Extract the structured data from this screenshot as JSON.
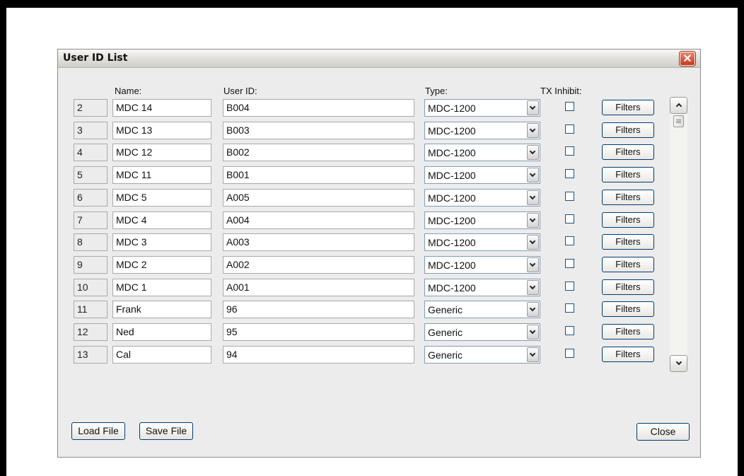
{
  "window": {
    "title": "User ID List",
    "close_glyph": "✕"
  },
  "columns": {
    "name": "Name:",
    "user_id": "User ID:",
    "type": "Type:",
    "tx_inhibit": "TX Inhibit:"
  },
  "rows": [
    {
      "num": "2",
      "name": "MDC 14",
      "user_id": "B004",
      "type": "MDC-1200",
      "tx_inhibit": false,
      "filters": "Filters"
    },
    {
      "num": "3",
      "name": "MDC 13",
      "user_id": "B003",
      "type": "MDC-1200",
      "tx_inhibit": false,
      "filters": "Filters"
    },
    {
      "num": "4",
      "name": "MDC 12",
      "user_id": "B002",
      "type": "MDC-1200",
      "tx_inhibit": false,
      "filters": "Filters"
    },
    {
      "num": "5",
      "name": "MDC 11",
      "user_id": "B001",
      "type": "MDC-1200",
      "tx_inhibit": false,
      "filters": "Filters"
    },
    {
      "num": "6",
      "name": "MDC 5",
      "user_id": "A005",
      "type": "MDC-1200",
      "tx_inhibit": false,
      "filters": "Filters"
    },
    {
      "num": "7",
      "name": "MDC 4",
      "user_id": "A004",
      "type": "MDC-1200",
      "tx_inhibit": false,
      "filters": "Filters"
    },
    {
      "num": "8",
      "name": "MDC 3",
      "user_id": "A003",
      "type": "MDC-1200",
      "tx_inhibit": false,
      "filters": "Filters"
    },
    {
      "num": "9",
      "name": "MDC 2",
      "user_id": "A002",
      "type": "MDC-1200",
      "tx_inhibit": false,
      "filters": "Filters"
    },
    {
      "num": "10",
      "name": "MDC 1",
      "user_id": "A001",
      "type": "MDC-1200",
      "tx_inhibit": false,
      "filters": "Filters"
    },
    {
      "num": "11",
      "name": "Frank",
      "user_id": "96",
      "type": "Generic",
      "tx_inhibit": false,
      "filters": "Filters"
    },
    {
      "num": "12",
      "name": "Ned",
      "user_id": "95",
      "type": "Generic",
      "tx_inhibit": false,
      "filters": "Filters"
    },
    {
      "num": "13",
      "name": "Cal",
      "user_id": "94",
      "type": "Generic",
      "tx_inhibit": false,
      "filters": "Filters"
    }
  ],
  "buttons": {
    "load": "Load File",
    "save": "Save File",
    "close": "Close"
  },
  "icons": {
    "window_close": "close-x-icon",
    "dropdown": "chevron-down-icon",
    "scroll_up": "chevron-up-icon",
    "scroll_down": "chevron-down-icon"
  },
  "colors": {
    "dialog_bg": "#ececec",
    "close_button": "#d8481f",
    "button_border": "#003c74",
    "checkbox_border": "#1c5180",
    "select_border": "#7f9db9"
  }
}
